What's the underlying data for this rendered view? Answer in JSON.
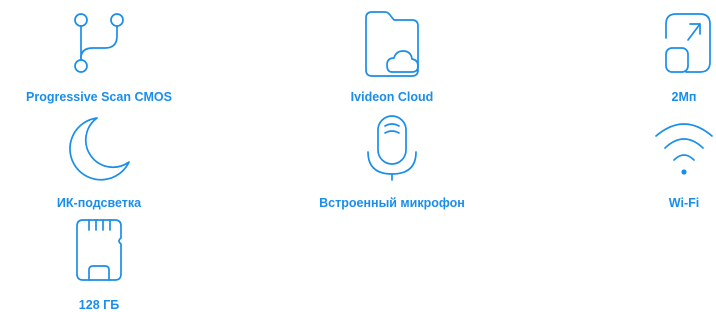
{
  "accent_color": "#1a8ee8",
  "features": [
    {
      "label": "Progressive Scan CMOS",
      "icon": "branch-icon"
    },
    {
      "label": "Ivideon Cloud",
      "icon": "cloud-folder-icon"
    },
    {
      "label": "2Мп",
      "icon": "expand-icon"
    },
    {
      "label": "ИК-подсветка",
      "icon": "moon-icon"
    },
    {
      "label": "Встроенный микрофон",
      "icon": "microphone-icon"
    },
    {
      "label": "Wi-Fi",
      "icon": "wifi-icon"
    },
    {
      "label": "128 ГБ",
      "icon": "sd-card-icon"
    }
  ]
}
